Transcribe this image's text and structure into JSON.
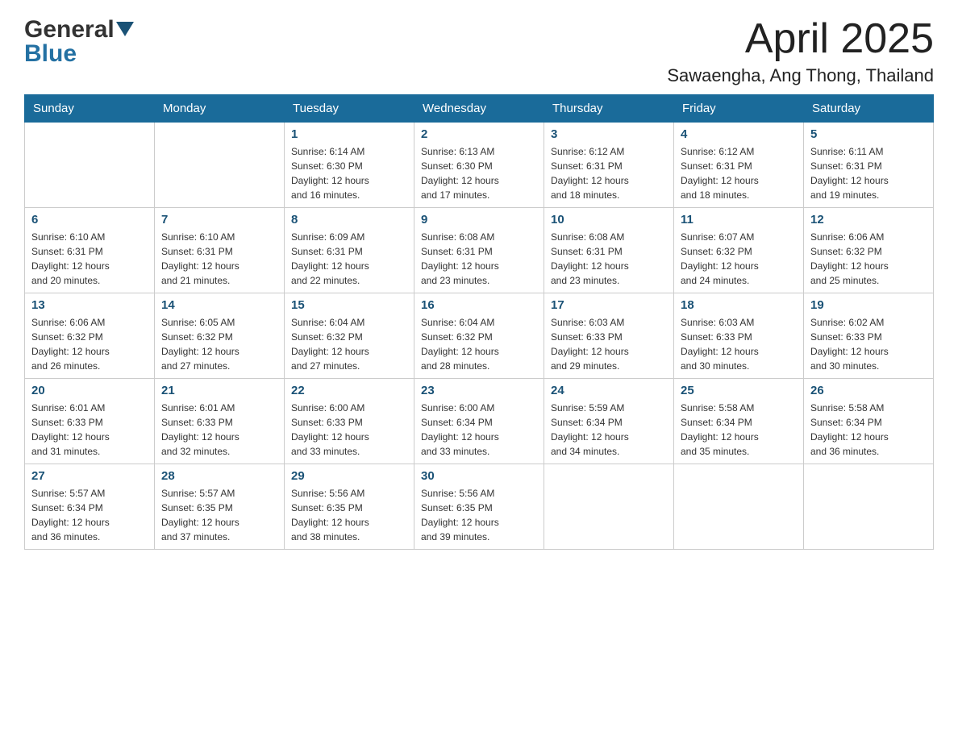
{
  "header": {
    "logo_general": "General",
    "logo_blue": "Blue",
    "month_title": "April 2025",
    "location": "Sawaengha, Ang Thong, Thailand"
  },
  "calendar": {
    "days_of_week": [
      "Sunday",
      "Monday",
      "Tuesday",
      "Wednesday",
      "Thursday",
      "Friday",
      "Saturday"
    ],
    "weeks": [
      [
        {
          "day": "",
          "info": ""
        },
        {
          "day": "",
          "info": ""
        },
        {
          "day": "1",
          "info": "Sunrise: 6:14 AM\nSunset: 6:30 PM\nDaylight: 12 hours\nand 16 minutes."
        },
        {
          "day": "2",
          "info": "Sunrise: 6:13 AM\nSunset: 6:30 PM\nDaylight: 12 hours\nand 17 minutes."
        },
        {
          "day": "3",
          "info": "Sunrise: 6:12 AM\nSunset: 6:31 PM\nDaylight: 12 hours\nand 18 minutes."
        },
        {
          "day": "4",
          "info": "Sunrise: 6:12 AM\nSunset: 6:31 PM\nDaylight: 12 hours\nand 18 minutes."
        },
        {
          "day": "5",
          "info": "Sunrise: 6:11 AM\nSunset: 6:31 PM\nDaylight: 12 hours\nand 19 minutes."
        }
      ],
      [
        {
          "day": "6",
          "info": "Sunrise: 6:10 AM\nSunset: 6:31 PM\nDaylight: 12 hours\nand 20 minutes."
        },
        {
          "day": "7",
          "info": "Sunrise: 6:10 AM\nSunset: 6:31 PM\nDaylight: 12 hours\nand 21 minutes."
        },
        {
          "day": "8",
          "info": "Sunrise: 6:09 AM\nSunset: 6:31 PM\nDaylight: 12 hours\nand 22 minutes."
        },
        {
          "day": "9",
          "info": "Sunrise: 6:08 AM\nSunset: 6:31 PM\nDaylight: 12 hours\nand 23 minutes."
        },
        {
          "day": "10",
          "info": "Sunrise: 6:08 AM\nSunset: 6:31 PM\nDaylight: 12 hours\nand 23 minutes."
        },
        {
          "day": "11",
          "info": "Sunrise: 6:07 AM\nSunset: 6:32 PM\nDaylight: 12 hours\nand 24 minutes."
        },
        {
          "day": "12",
          "info": "Sunrise: 6:06 AM\nSunset: 6:32 PM\nDaylight: 12 hours\nand 25 minutes."
        }
      ],
      [
        {
          "day": "13",
          "info": "Sunrise: 6:06 AM\nSunset: 6:32 PM\nDaylight: 12 hours\nand 26 minutes."
        },
        {
          "day": "14",
          "info": "Sunrise: 6:05 AM\nSunset: 6:32 PM\nDaylight: 12 hours\nand 27 minutes."
        },
        {
          "day": "15",
          "info": "Sunrise: 6:04 AM\nSunset: 6:32 PM\nDaylight: 12 hours\nand 27 minutes."
        },
        {
          "day": "16",
          "info": "Sunrise: 6:04 AM\nSunset: 6:32 PM\nDaylight: 12 hours\nand 28 minutes."
        },
        {
          "day": "17",
          "info": "Sunrise: 6:03 AM\nSunset: 6:33 PM\nDaylight: 12 hours\nand 29 minutes."
        },
        {
          "day": "18",
          "info": "Sunrise: 6:03 AM\nSunset: 6:33 PM\nDaylight: 12 hours\nand 30 minutes."
        },
        {
          "day": "19",
          "info": "Sunrise: 6:02 AM\nSunset: 6:33 PM\nDaylight: 12 hours\nand 30 minutes."
        }
      ],
      [
        {
          "day": "20",
          "info": "Sunrise: 6:01 AM\nSunset: 6:33 PM\nDaylight: 12 hours\nand 31 minutes."
        },
        {
          "day": "21",
          "info": "Sunrise: 6:01 AM\nSunset: 6:33 PM\nDaylight: 12 hours\nand 32 minutes."
        },
        {
          "day": "22",
          "info": "Sunrise: 6:00 AM\nSunset: 6:33 PM\nDaylight: 12 hours\nand 33 minutes."
        },
        {
          "day": "23",
          "info": "Sunrise: 6:00 AM\nSunset: 6:34 PM\nDaylight: 12 hours\nand 33 minutes."
        },
        {
          "day": "24",
          "info": "Sunrise: 5:59 AM\nSunset: 6:34 PM\nDaylight: 12 hours\nand 34 minutes."
        },
        {
          "day": "25",
          "info": "Sunrise: 5:58 AM\nSunset: 6:34 PM\nDaylight: 12 hours\nand 35 minutes."
        },
        {
          "day": "26",
          "info": "Sunrise: 5:58 AM\nSunset: 6:34 PM\nDaylight: 12 hours\nand 36 minutes."
        }
      ],
      [
        {
          "day": "27",
          "info": "Sunrise: 5:57 AM\nSunset: 6:34 PM\nDaylight: 12 hours\nand 36 minutes."
        },
        {
          "day": "28",
          "info": "Sunrise: 5:57 AM\nSunset: 6:35 PM\nDaylight: 12 hours\nand 37 minutes."
        },
        {
          "day": "29",
          "info": "Sunrise: 5:56 AM\nSunset: 6:35 PM\nDaylight: 12 hours\nand 38 minutes."
        },
        {
          "day": "30",
          "info": "Sunrise: 5:56 AM\nSunset: 6:35 PM\nDaylight: 12 hours\nand 39 minutes."
        },
        {
          "day": "",
          "info": ""
        },
        {
          "day": "",
          "info": ""
        },
        {
          "day": "",
          "info": ""
        }
      ]
    ]
  }
}
